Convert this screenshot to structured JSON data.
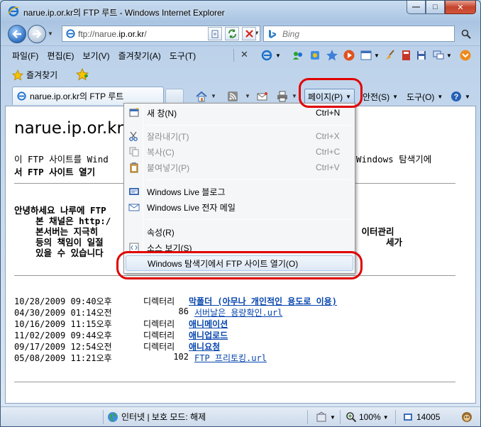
{
  "window": {
    "title": "narue.ip.or.kr의 FTP 루트 - Windows Internet Explorer",
    "minimize_glyph": "—",
    "maximize_glyph": "□",
    "close_glyph": "✕"
  },
  "address": {
    "url_prefix": "ftp://narue.",
    "url_host": "ip.or.kr",
    "url_suffix": "/"
  },
  "search": {
    "placeholder": "Bing"
  },
  "menu": {
    "items": [
      "파일(F)",
      "편집(E)",
      "보기(V)",
      "즐겨찾기(A)",
      "도구(T)"
    ],
    "close_glyph": "✕"
  },
  "favorites": {
    "label": "즐겨찾기"
  },
  "tab": {
    "label": "narue.ip.or.kr의 FTP 루트"
  },
  "command_bar": {
    "page_label": "페이지(P)",
    "safety_label": "안전(S)",
    "tools_label": "도구(O)"
  },
  "content": {
    "title": "narue.ip.or.kr",
    "intro_line1": "이 FTP 사이트를 Wind",
    "intro_line1_end": "Windows 탐색기에",
    "intro_line2": "서 FTP 사이트 열기",
    "greeting_line1": "안녕하세요 나루에 FTP",
    "greeting_line2": "    본 채널은 http:/",
    "greeting_line3": "    본서버는 지극히",
    "greeting_line3_end": " 이터관리",
    "greeting_line4": "    등의 책임이 일절",
    "greeting_line4_end": "세가",
    "greeting_line5": "    있을 수 있습니다",
    "listing": [
      {
        "date": "10/28/2009 09:40오후",
        "type": "디렉터리",
        "size": "",
        "name": "막폴더 (아무나 개인적인 용도로 이용)",
        "dir": true
      },
      {
        "date": "04/30/2009 01:14오전",
        "type": "",
        "size": "86",
        "name": "서버날은 용량확인.url",
        "dir": false
      },
      {
        "date": "10/16/2009 11:15오후",
        "type": "디렉터리",
        "size": "",
        "name": "애니메이션",
        "dir": true
      },
      {
        "date": "11/02/2009 09:44오후",
        "type": "디렉터리",
        "size": "",
        "name": "애니업로드",
        "dir": true
      },
      {
        "date": "09/17/2009 12:54오전",
        "type": "디렉터리",
        "size": "",
        "name": "애니요청",
        "dir": true
      },
      {
        "date": "05/08/2009 11:21오후",
        "type": "",
        "size": "102",
        "name": "FTP 프리토킹.url",
        "dir": false
      }
    ]
  },
  "page_menu": {
    "items": [
      {
        "label": "새 창(N)",
        "shortcut": "Ctrl+N",
        "disabled": false
      },
      {
        "label": "잘라내기(T)",
        "shortcut": "Ctrl+X",
        "disabled": true
      },
      {
        "label": "복사(C)",
        "shortcut": "Ctrl+C",
        "disabled": true
      },
      {
        "label": "붙여넣기(P)",
        "shortcut": "Ctrl+V",
        "disabled": true
      },
      {
        "label": "Windows Live 블로그",
        "shortcut": "",
        "disabled": false
      },
      {
        "label": "Windows Live 전자 메일",
        "shortcut": "",
        "disabled": false
      },
      {
        "label": "속성(R)",
        "shortcut": "",
        "disabled": false
      },
      {
        "label": "소스 보기(S)",
        "shortcut": "",
        "disabled": false
      },
      {
        "label": "Windows 탐색기에서 FTP 사이트 열기(O)",
        "shortcut": "",
        "disabled": false
      }
    ]
  },
  "status": {
    "zone": "인터넷 | 보호 모드: 해제",
    "zoom": "100%",
    "count": "14005"
  },
  "colors": {
    "highlight_oval": "#e00000",
    "link": "#0645ad"
  }
}
